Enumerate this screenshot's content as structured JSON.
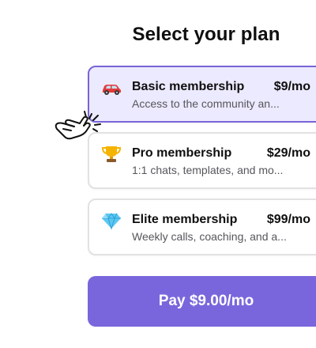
{
  "title": "Select your plan",
  "plans": [
    {
      "name": "Basic membership",
      "price": "$9/mo",
      "description": "Access to the community an...",
      "icon": "car-icon",
      "selected": true
    },
    {
      "name": "Pro membership",
      "price": "$29/mo",
      "description": "1:1 chats, templates, and mo...",
      "icon": "trophy-icon",
      "selected": false
    },
    {
      "name": "Elite membership",
      "price": "$99/mo",
      "description": "Weekly calls, coaching, and a...",
      "icon": "gem-icon",
      "selected": false
    }
  ],
  "pay_button": {
    "label": "Pay $9.00/mo"
  },
  "colors": {
    "accent": "#7a66dc",
    "selected_bg": "#eceafe",
    "selected_border": "#7a64d6"
  }
}
